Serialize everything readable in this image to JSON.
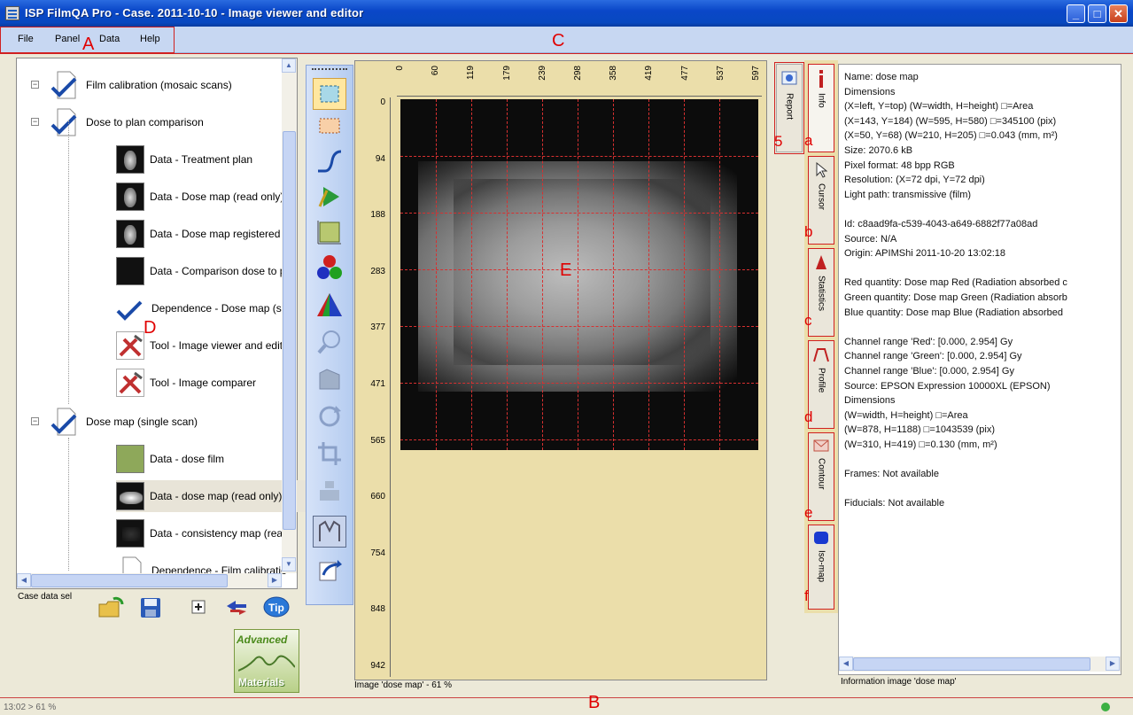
{
  "window": {
    "title": "ISP FilmQA Pro - Case. 2011-10-10 - Image viewer and editor",
    "buttons": {
      "minimize": "_",
      "maximize": "□",
      "close": "✕"
    }
  },
  "menu": [
    "File",
    "Panel",
    "Data",
    "Help"
  ],
  "callouts": {
    "A": "A",
    "B": "B",
    "C": "C",
    "D": "D",
    "E": "E",
    "a": "a",
    "b": "b",
    "c": "c",
    "d": "d",
    "e": "e",
    "f": "f",
    "five": "5"
  },
  "tree": [
    {
      "label": "Film calibration (mosaic scans)",
      "icon": "check-doc-icon"
    },
    {
      "label": "Dose to plan comparison",
      "icon": "check-doc-icon"
    },
    {
      "label": "Data - Treatment plan",
      "icon": "dose-thumbnail"
    },
    {
      "label": "Data - Dose map (read only)",
      "icon": "dose-thumbnail"
    },
    {
      "label": "Data - Dose map registered (",
      "icon": "dose-thumbnail"
    },
    {
      "label": "Data - Comparison dose to pl",
      "icon": "black-thumbnail"
    },
    {
      "label": "Dependence - Dose map (sin",
      "icon": "checkmark-icon"
    },
    {
      "label": "Tool - Image viewer and edito",
      "icon": "tools-icon"
    },
    {
      "label": "Tool - Image comparer",
      "icon": "tools-icon"
    },
    {
      "label": "Dose map (single scan)",
      "icon": "check-doc-icon"
    },
    {
      "label": "Data - dose film",
      "icon": "film-thumbnail"
    },
    {
      "label": "Data - dose map (read only)",
      "icon": "dose-thumbnail"
    },
    {
      "label": "Data - consistency map (reac",
      "icon": "black-thumbnail"
    },
    {
      "label": "Dependence - Film calibratio",
      "icon": "doc-icon"
    }
  ],
  "left_bottom": {
    "case_label": "Case  data sel",
    "logo_line1": "Advanced",
    "logo_line2": "Materials"
  },
  "image": {
    "caption": "Image 'dose map' - 61 %",
    "x_ticks": [
      "0",
      "60",
      "119",
      "179",
      "239",
      "298",
      "358",
      "419",
      "477",
      "537",
      "597"
    ],
    "y_ticks": [
      "0",
      "94",
      "188",
      "283",
      "377",
      "471",
      "565",
      "660",
      "754",
      "848",
      "942"
    ]
  },
  "tabs": {
    "report": "Report",
    "info": "Info",
    "cursor": "Cursor",
    "statistics": "Statistics",
    "profile": "Profile",
    "contour": "Contour",
    "isomap": "Iso-map"
  },
  "info": [
    "Name: dose map",
    "Dimensions",
    "(X=left, Y=top) (W=width, H=height) □=Area",
    "(X=143, Y=184) (W=595, H=580) □=345100  (pix)",
    "(X=50, Y=68) (W=210, H=205) □=0.043  (mm, m²)",
    "Size:  2070.6 kB",
    "Pixel format:  48 bpp RGB",
    "Resolution:  (X=72 dpi, Y=72 dpi)",
    "Light path:  transmissive (film)",
    "",
    "Id:  c8aad9fa-c539-4043-a649-6882f77a08ad",
    "Source:  N/A",
    "Origin:  APIMShi 2011-10-20 13:02:18",
    "",
    "Red quantity: Dose map Red (Radiation absorbed c",
    "Green quantity: Dose map Green (Radiation absorb",
    "Blue quantity: Dose map Blue (Radiation absorbed",
    "",
    "Channel range 'Red':  [0.000, 2.954] Gy",
    "Channel range 'Green':  [0.000, 2.954] Gy",
    "Channel range 'Blue':  [0.000, 2.954] Gy",
    "Source:  EPSON Expression 10000XL  (EPSON)",
    "Dimensions",
    "(W=width, H=height) □=Area",
    "(W=878, H=1188) □=1043539  (pix)",
    "(W=310, H=419) □=0.130  (mm, m²)",
    "",
    "Frames:  Not available",
    "",
    "Fiducials:  Not available"
  ],
  "info_footer": "Information image 'dose map'",
  "status": "13:02 > 61 %"
}
